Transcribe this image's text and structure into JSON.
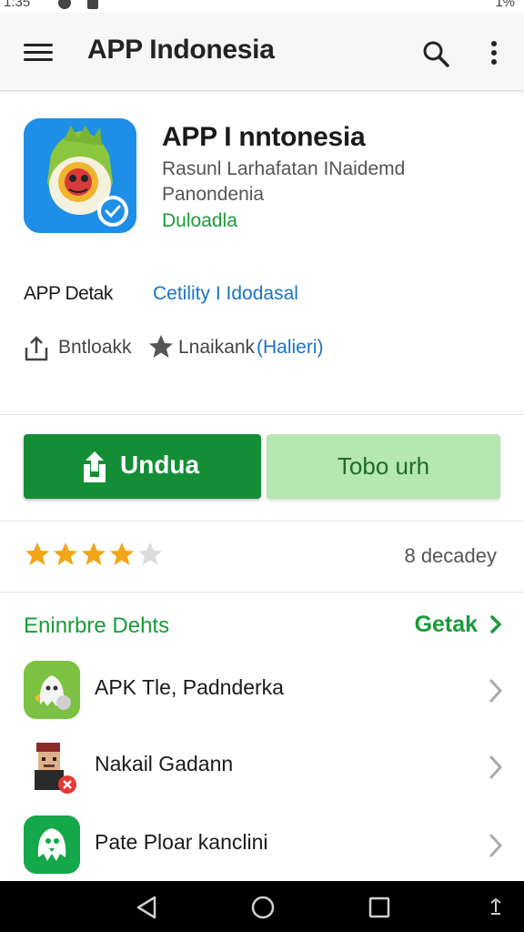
{
  "status_bar": {
    "time": "1:35",
    "right_text": "1%"
  },
  "app_bar": {
    "title": "APP Indonesia"
  },
  "app": {
    "name": "APP I nntonesia",
    "developer": "Rasunl Larhafatan INaidemd",
    "subtitle": "Panondenia",
    "tag": "Duloadla"
  },
  "details": {
    "label": "APP Detak",
    "link": "Cetility I Idodasal"
  },
  "meta_row": {
    "share_label": "Bntloakk",
    "rank_label": "Lnaikank",
    "rank_link": "(Halieri)"
  },
  "buttons": {
    "install_label": "Undua",
    "secondary_label": "Tobo urh"
  },
  "rating": {
    "stars_filled": 4,
    "stars_total": 5,
    "text": "8 decadey"
  },
  "section": {
    "title": "Eninrbre Dehts",
    "more_label": "Getak"
  },
  "list": [
    {
      "title": "APK Tle, Padnderka"
    },
    {
      "title": "Nakail Gadann"
    },
    {
      "title": "Pate Ploar kanclini"
    }
  ],
  "colors": {
    "primary_green": "#138e37",
    "light_green": "#b6e6b2",
    "link_blue": "#1a73c8",
    "star_orange": "#f2a516"
  }
}
